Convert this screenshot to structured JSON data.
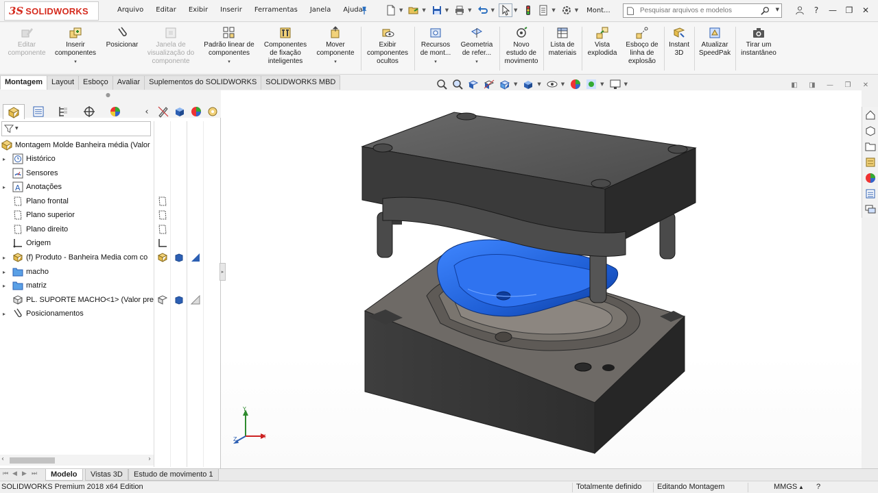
{
  "app": {
    "logo_prefix": "3S",
    "logo_text": "SOLIDWORKS"
  },
  "menubar": [
    "Arquivo",
    "Editar",
    "Exibir",
    "Inserir",
    "Ferramentas",
    "Janela",
    "Ajuda"
  ],
  "quickbar": {
    "doc_label": "Mont..."
  },
  "search": {
    "placeholder": "Pesquisar arquivos e modelos"
  },
  "ribbon": {
    "buttons": [
      {
        "label": "Editar\ncomponente",
        "disabled": true,
        "dropdown": false,
        "icon": "edit-component-icon"
      },
      {
        "label": "Inserir\ncomponentes",
        "disabled": false,
        "dropdown": true,
        "icon": "insert-components-icon"
      },
      {
        "label": "Posicionar",
        "disabled": false,
        "dropdown": false,
        "icon": "mate-icon"
      },
      {
        "label": "Janela de\nvisualização do\ncomponente",
        "disabled": true,
        "dropdown": false,
        "icon": "component-preview-icon"
      },
      {
        "label": "Padrão linear de\ncomponentes",
        "disabled": false,
        "dropdown": true,
        "icon": "linear-pattern-icon"
      },
      {
        "label": "Componentes\nde fixação\ninteligentes",
        "disabled": false,
        "dropdown": false,
        "icon": "smart-fasteners-icon"
      },
      {
        "label": "Mover\ncomponente",
        "disabled": false,
        "dropdown": true,
        "icon": "move-component-icon"
      },
      {
        "label": "Exibir\ncomponentes\nocultos",
        "disabled": false,
        "dropdown": false,
        "icon": "show-hidden-icon"
      },
      {
        "label": "Recursos\nde mont...",
        "disabled": false,
        "dropdown": true,
        "icon": "assembly-features-icon"
      },
      {
        "label": "Geometria\nde refer...",
        "disabled": false,
        "dropdown": true,
        "icon": "reference-geometry-icon"
      },
      {
        "label": "Novo\nestudo de\nmovimento",
        "disabled": false,
        "dropdown": false,
        "icon": "motion-study-icon"
      },
      {
        "label": "Lista de\nmateriais",
        "disabled": false,
        "dropdown": false,
        "icon": "bill-of-materials-icon"
      },
      {
        "label": "Vista\nexplodida",
        "disabled": false,
        "dropdown": false,
        "icon": "exploded-view-icon"
      },
      {
        "label": "Esboço de\nlinha de\nexplosão",
        "disabled": false,
        "dropdown": false,
        "icon": "explode-line-sketch-icon"
      },
      {
        "label": "Instant\n3D",
        "disabled": false,
        "dropdown": false,
        "icon": "instant3d-icon"
      },
      {
        "label": "Atualizar\nSpeedPak",
        "disabled": false,
        "dropdown": false,
        "icon": "speedpak-icon"
      },
      {
        "label": "Tirar um\ninstantâneo",
        "disabled": false,
        "dropdown": false,
        "icon": "camera-icon"
      }
    ]
  },
  "cm_tabs": [
    {
      "label": "Montagem",
      "active": true
    },
    {
      "label": "Layout",
      "active": false
    },
    {
      "label": "Esboço",
      "active": false
    },
    {
      "label": "Avaliar",
      "active": false
    },
    {
      "label": "Suplementos do SOLIDWORKS",
      "active": false
    },
    {
      "label": "SOLIDWORKS MBD",
      "active": false
    }
  ],
  "tree": {
    "root": "Montagem Molde Banheira média  (Valor",
    "items": [
      {
        "label": "Histórico",
        "expandable": true,
        "icon": "history-icon"
      },
      {
        "label": "Sensores",
        "expandable": false,
        "icon": "sensor-icon"
      },
      {
        "label": "Anotações",
        "expandable": true,
        "icon": "annotations-icon"
      },
      {
        "label": "Plano frontal",
        "expandable": false,
        "icon": "plane-icon"
      },
      {
        "label": "Plano superior",
        "expandable": false,
        "icon": "plane-icon"
      },
      {
        "label": "Plano direito",
        "expandable": false,
        "icon": "plane-icon"
      },
      {
        "label": "Origem",
        "expandable": false,
        "icon": "origin-icon"
      },
      {
        "label": "(f) Produto - Banheira Media com co",
        "expandable": true,
        "icon": "part-icon"
      },
      {
        "label": "macho",
        "expandable": true,
        "icon": "folder-icon"
      },
      {
        "label": "matriz",
        "expandable": true,
        "icon": "folder-icon"
      },
      {
        "label": "PL. SUPORTE MACHO<1> (Valor pre",
        "expandable": false,
        "icon": "part-icon"
      },
      {
        "label": "Posicionamentos",
        "expandable": true,
        "icon": "mates-icon"
      }
    ]
  },
  "bottom_tabs": [
    {
      "label": "Modelo",
      "active": true
    },
    {
      "label": "Vistas 3D",
      "active": false
    },
    {
      "label": "Estudo de movimento 1",
      "active": false
    }
  ],
  "status": {
    "edition": "SOLIDWORKS Premium 2018 x64 Edition",
    "definition": "Totalmente definido",
    "mode": "Editando Montagem",
    "units": "MMGS"
  },
  "triad": {
    "x": "X",
    "y": "Y",
    "z": "Z"
  },
  "colors": {
    "mold_dark": "#3a3a3a",
    "mold_top": "#5a5a5a",
    "product_blue": "#1f5fd6",
    "logo_red": "#d52b1e"
  }
}
